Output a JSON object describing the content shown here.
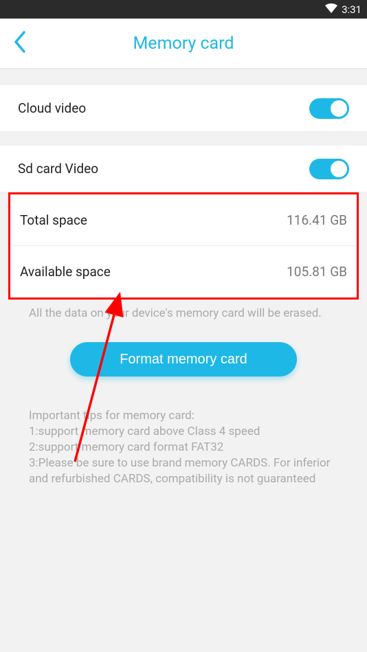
{
  "status_bar": {
    "time": "3:31"
  },
  "header": {
    "title": "Memory card"
  },
  "settings": {
    "cloud_video_label": "Cloud video",
    "sd_card_video_label": "Sd card Video"
  },
  "stats": {
    "total_space_label": "Total space",
    "total_space_value": "116.41 GB",
    "available_space_label": "Available space",
    "available_space_value": "105.81 GB"
  },
  "erase_warning": "All the data on your device's memory card will be erased.",
  "format_button_label": "Format memory card",
  "tips": {
    "heading": "Important tips for memory card:",
    "line1": " 1:support memory card above Class 4 speed",
    "line2": " 2:support memory card format FAT32",
    "line3": " 3:Please be sure to use brand memory CARDS. For inferior and refurbished CARDS, compatibility is not guaranteed"
  }
}
